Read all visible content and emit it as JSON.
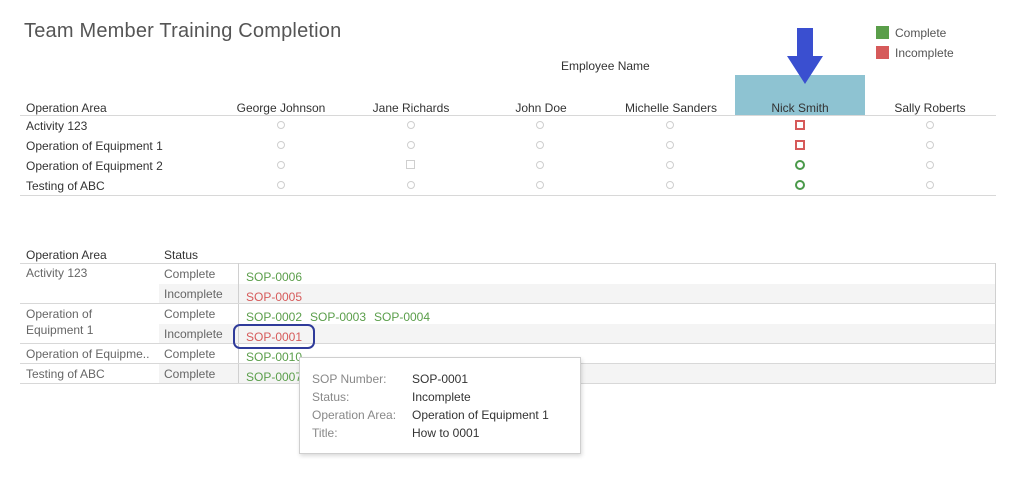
{
  "title": "Team Member Training Completion",
  "legend": [
    {
      "label": "Complete",
      "color": "#5a9e4a"
    },
    {
      "label": "Incomplete",
      "color": "#d65a5a"
    }
  ],
  "employee_header": "Employee Name",
  "matrix": {
    "row_header": "Operation Area",
    "employees": [
      "George Johnson",
      "Jane Richards",
      "John Doe",
      "Michelle Sanders",
      "Nick Smith",
      "Sally Roberts"
    ],
    "highlighted_employee": "Nick Smith",
    "rows": [
      "Activity 123",
      "Operation of Equipment 1",
      "Operation of Equipment 2",
      "Testing of ABC"
    ]
  },
  "detail": {
    "headers": [
      "Operation Area",
      "Status"
    ],
    "areas": [
      "Activity 123",
      "Operation of\nEquipment 1",
      "Operation of Equipme..",
      "Testing of ABC"
    ],
    "statuses": [
      "Complete",
      "Incomplete",
      "Complete",
      "Incomplete",
      "Complete",
      "Complete"
    ],
    "sops": [
      "SOP-0006",
      "SOP-0005",
      "SOP-0002",
      "SOP-0003",
      "SOP-0004",
      "SOP-0001",
      "SOP-0010",
      "SOP-0007"
    ]
  },
  "tooltip": {
    "rows": [
      {
        "key": "SOP Number:",
        "value": "SOP-0001"
      },
      {
        "key": "Status:",
        "value": "Incomplete"
      },
      {
        "key": "Operation Area:",
        "value": "Operation of Equipment 1"
      },
      {
        "key": "Title:",
        "value": "How to 0001"
      }
    ]
  },
  "colors": {
    "complete": "#5a9e4a",
    "incomplete": "#d65a5a",
    "highlight": "#8ec3d2",
    "arrow": "#3a4fd0"
  }
}
